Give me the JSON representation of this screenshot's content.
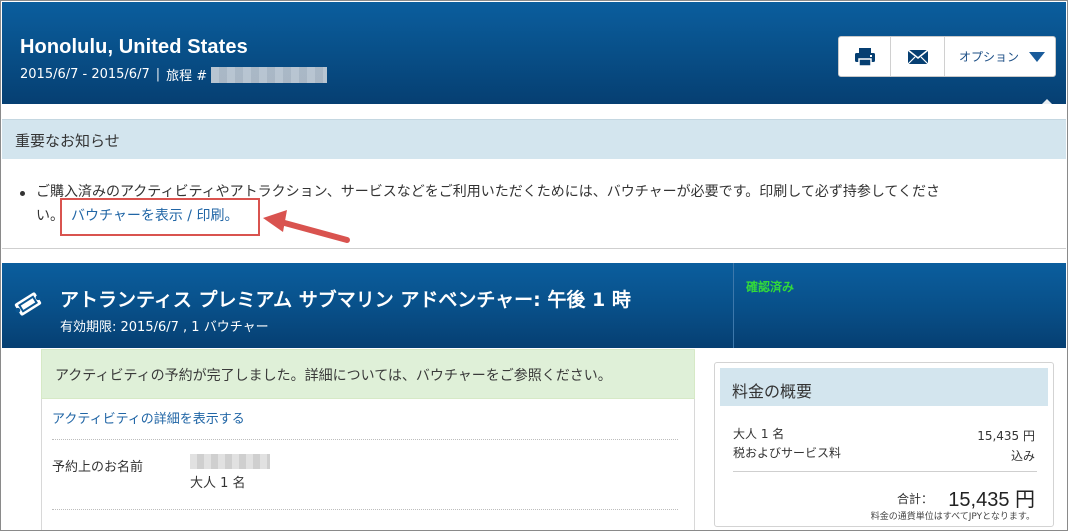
{
  "header": {
    "title": "Honolulu, United States",
    "dates": "2015/6/7 - 2015/6/7",
    "itinerary_label": "旅程 #",
    "buttons": {
      "print_icon": "printer-icon",
      "mail_icon": "envelope-icon",
      "options_label": "オプション"
    }
  },
  "notice": {
    "heading": "重要なお知らせ",
    "text_line1": "ご購入済みのアクティビティやアトラクション、サービスなどをご利用いただくためには、バウチャーが必要です。印刷して必ず持参してくださ",
    "text_line2": "い。",
    "voucher_link": "バウチャーを表示 / 印刷。"
  },
  "activity": {
    "icon": "ticket-icon",
    "title": "アトランティス プレミアム サブマリン アドベンチャー: 午後 1 時",
    "validity": "有効期限: 2015/6/7 , 1 バウチャー",
    "status": "確認済み",
    "confirm_message": "アクティビティの予約が完了しました。詳細については、バウチャーをご参照ください。",
    "details_link": "アクティビティの詳細を表示する",
    "reservation_name_label": "予約上のお名前",
    "party": "大人 1 名"
  },
  "price_summary": {
    "heading": "料金の概要",
    "rows": [
      {
        "label": "大人 1 名",
        "value": "15,435 円"
      },
      {
        "label": "税およびサービス料",
        "value": "込み"
      }
    ],
    "total_label": "合計：",
    "total_value": "15,435 円",
    "currency_note": "料金の通貨単位はすべてJPYとなります。"
  },
  "colors": {
    "header_blue": "#084f88",
    "notice_bg": "#d3e5ee",
    "success_bg": "#dff0d8",
    "link": "#2166a6",
    "status_green": "#32d93a",
    "highlight_red": "#d9534f"
  }
}
